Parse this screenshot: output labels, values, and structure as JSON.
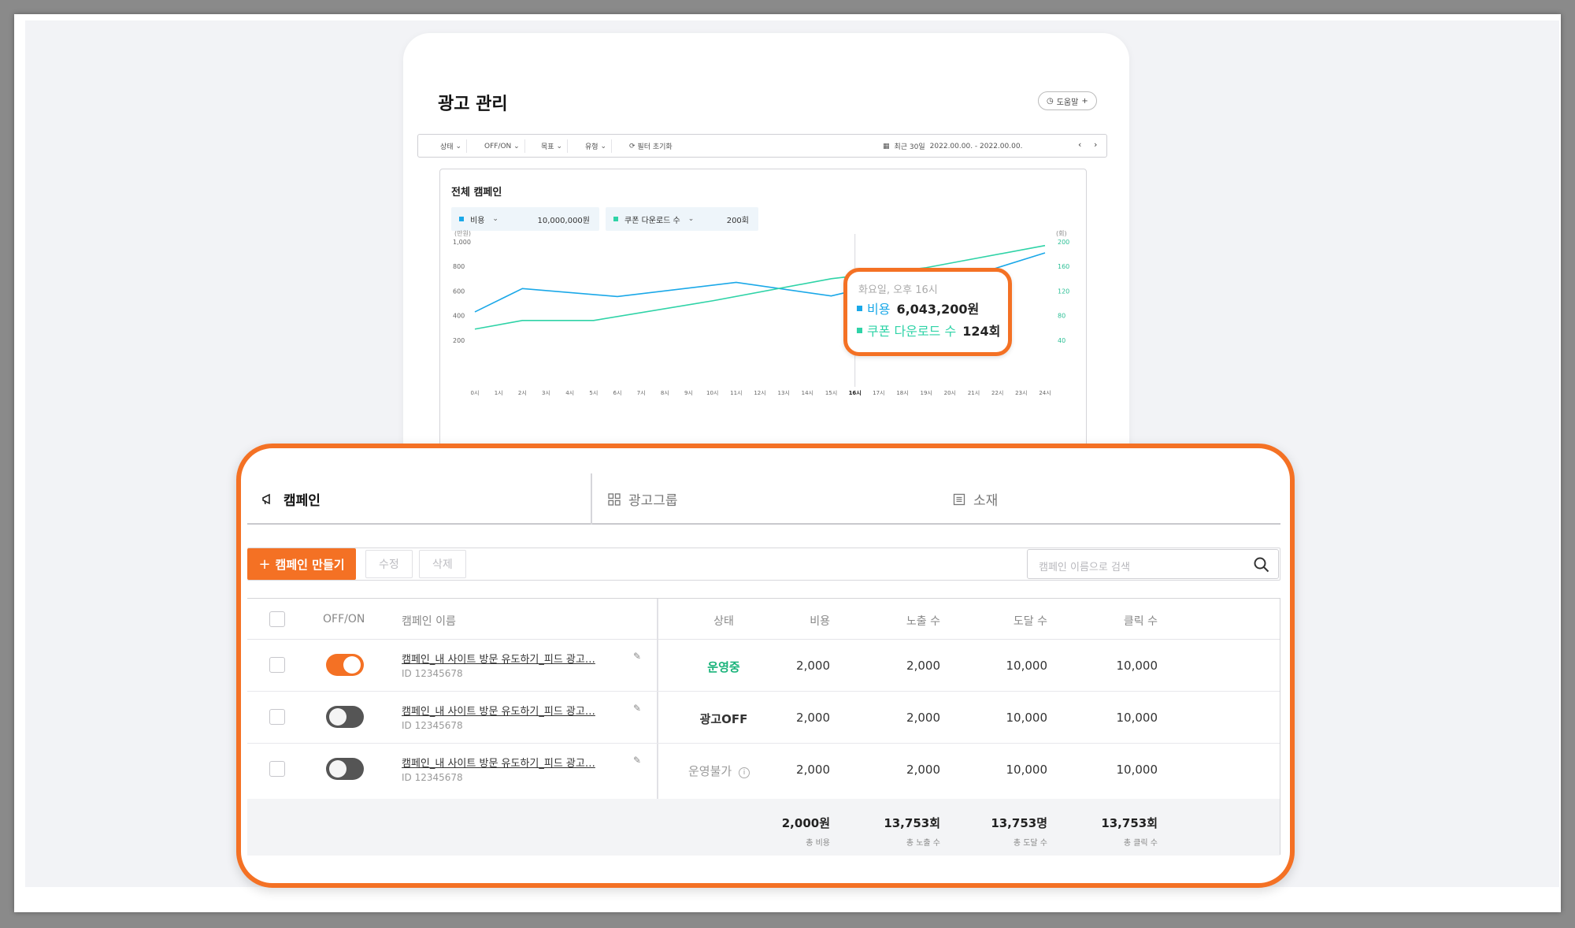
{
  "page_title": "광고 관리",
  "help_button": "도움말",
  "filters": {
    "chips": [
      "상태",
      "OFF/ON",
      "목표",
      "유형"
    ],
    "reset": "필터 초기화",
    "period": "최근 30일",
    "date_range": "2022.00.00. - 2022.00.00."
  },
  "chart_card": {
    "title": "전체 캠페인",
    "metric1": {
      "label": "비용",
      "value": "10,000,000원",
      "color": "#1aa8e8"
    },
    "metric2": {
      "label": "쿠폰 다운로드 수",
      "value": "200회",
      "color": "#2fd3a7"
    }
  },
  "chart_data": {
    "type": "line",
    "x": [
      "0시",
      "1시",
      "2시",
      "3시",
      "4시",
      "5시",
      "6시",
      "7시",
      "8시",
      "9시",
      "10시",
      "11시",
      "12시",
      "13시",
      "14시",
      "15시",
      "16시",
      "17시",
      "18시",
      "19시",
      "20시",
      "21시",
      "22시",
      "23시",
      "24시"
    ],
    "y_left": {
      "unit": "(만원)",
      "ticks": [
        200,
        400,
        600,
        800,
        1000
      ],
      "range": [
        0,
        1000
      ]
    },
    "y_right": {
      "unit": "(회)",
      "ticks": [
        40,
        80,
        120,
        160,
        200
      ],
      "range": [
        0,
        200
      ]
    },
    "highlight_x": "16시",
    "series": [
      {
        "name": "비용",
        "axis": "left",
        "color": "#1aa8e8",
        "points": [
          [
            0,
            430
          ],
          [
            2,
            620
          ],
          [
            6,
            555
          ],
          [
            11,
            670
          ],
          [
            15,
            560
          ],
          [
            17,
            650
          ],
          [
            20,
            670
          ],
          [
            24,
            910
          ]
        ]
      },
      {
        "name": "쿠폰 다운로드 수",
        "axis": "right",
        "color": "#2fd3a7",
        "points": [
          [
            0,
            58
          ],
          [
            2,
            72
          ],
          [
            5,
            72
          ],
          [
            10,
            104
          ],
          [
            15,
            140
          ],
          [
            19,
            158
          ],
          [
            24,
            194
          ]
        ]
      }
    ]
  },
  "tooltip": {
    "time": "화요일, 오후 16시",
    "row1_label": "비용",
    "row1_value": "6,043,200원",
    "row2_label": "쿠폰 다운로드 수",
    "row2_value": "124회"
  },
  "tabs": [
    {
      "label": "캠페인",
      "icon": "megaphone-icon"
    },
    {
      "label": "광고그룹",
      "icon": "grid-icon"
    },
    {
      "label": "소재",
      "icon": "document-icon"
    }
  ],
  "toolbar": {
    "create": "캠페인 만들기",
    "edit": "수정",
    "delete": "삭제",
    "search_placeholder": "캠페인 이름으로 검색"
  },
  "table": {
    "headers": [
      "OFF/ON",
      "캠페인 이름",
      "상태",
      "비용",
      "노출 수",
      "도달 수",
      "클릭 수"
    ],
    "rows": [
      {
        "on": true,
        "name": "캠페인_내 사이트 방문 유도하기_피드 광고…",
        "id": "ID 12345678",
        "status": "운영중",
        "cost": "2,000",
        "impressions": "2,000",
        "reach": "10,000",
        "clicks": "10,000"
      },
      {
        "on": false,
        "name": "캠페인_내 사이트 방문 유도하기_피드 광고…",
        "id": "ID 12345678",
        "status": "광고OFF",
        "cost": "2,000",
        "impressions": "2,000",
        "reach": "10,000",
        "clicks": "10,000"
      },
      {
        "on": false,
        "name": "캠페인_내 사이트 방문 유도하기_피드 광고…",
        "id": "ID 12345678",
        "status": "운영불가",
        "cost": "2,000",
        "impressions": "2,000",
        "reach": "10,000",
        "clicks": "10,000"
      }
    ],
    "totals": [
      {
        "value": "2,000원",
        "label": "총 비용"
      },
      {
        "value": "13,753회",
        "label": "총 노출 수"
      },
      {
        "value": "13,753명",
        "label": "총 도달 수"
      },
      {
        "value": "13,753회",
        "label": "총 클릭 수"
      }
    ]
  },
  "colors": {
    "accent": "#f47124",
    "running": "#19b37a",
    "off": "#333333",
    "unavailable": "#9a9a9a"
  }
}
